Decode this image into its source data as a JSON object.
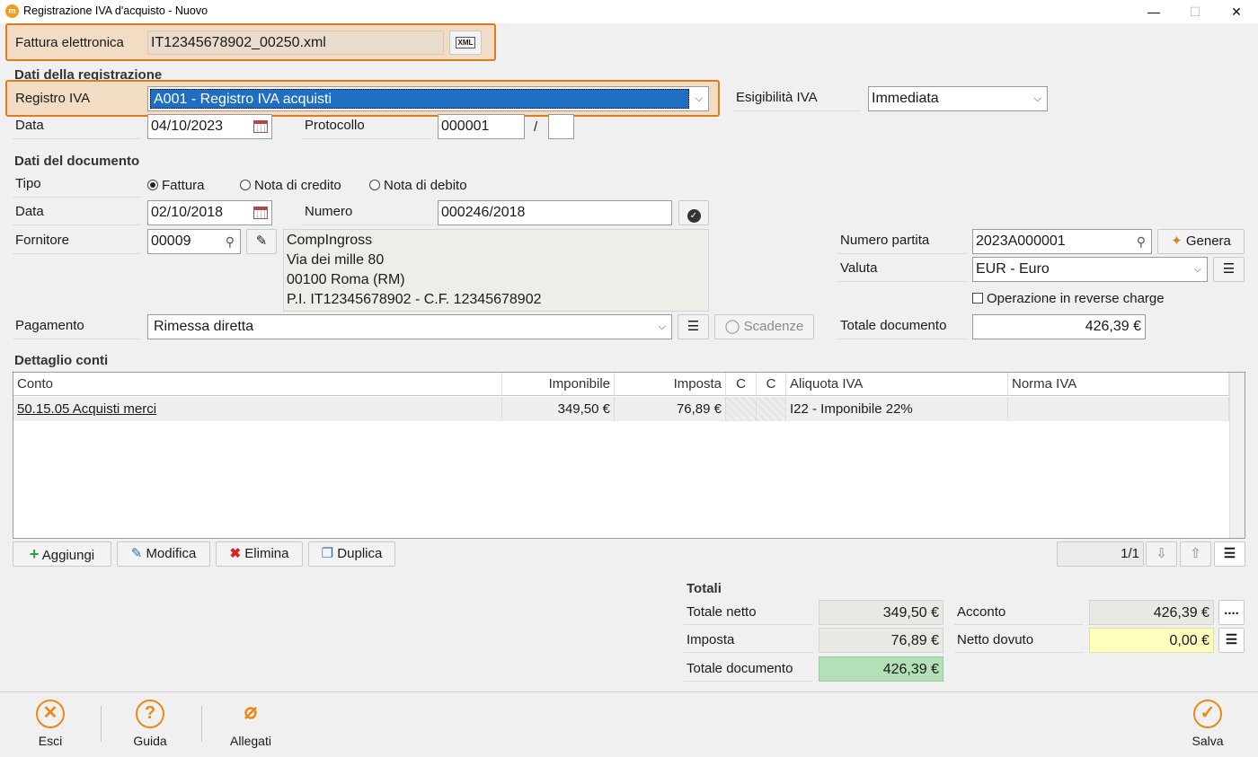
{
  "window": {
    "title": "Registrazione IVA d'acquisto - Nuovo",
    "minimize": "—",
    "maximize": "☐",
    "close": "✕"
  },
  "fattura": {
    "label": "Fattura elettronica",
    "value": "IT12345678902_00250.xml",
    "xml_btn": "XML"
  },
  "registrazione": {
    "section": "Dati della registrazione",
    "registro_label": "Registro IVA",
    "registro_value": "A001 - Registro IVA acquisti",
    "esigibilita_label": "Esigibilità IVA",
    "esigibilita_value": "Immediata",
    "data_label": "Data",
    "data_value": "04/10/2023",
    "protocollo_label": "Protocollo",
    "protocollo_value": "000001",
    "protocollo_sep": "/",
    "protocollo_suffix": ""
  },
  "documento": {
    "section": "Dati del documento",
    "tipo_label": "Tipo",
    "tipi": [
      "Fattura",
      "Nota di credito",
      "Nota di debito"
    ],
    "tipo_selected": "Fattura",
    "data_label": "Data",
    "data_value": "02/10/2018",
    "numero_label": "Numero",
    "numero_value": "000246/2018",
    "fornitore_label": "Fornitore",
    "fornitore_code": "00009",
    "fornitore_lines": [
      "CompIngross",
      "Via dei mille 80",
      "00100 Roma (RM)",
      "P.I. IT12345678902 - C.F. 12345678902"
    ],
    "numero_partita_label": "Numero partita",
    "numero_partita_value": "2023A000001",
    "genera_label": "Genera",
    "valuta_label": "Valuta",
    "valuta_value": "EUR - Euro",
    "reverse_charge_label": "Operazione in reverse charge",
    "pagamento_label": "Pagamento",
    "pagamento_value": "Rimessa diretta",
    "scadenze_label": "Scadenze",
    "totale_documento_label": "Totale documento",
    "totale_documento_value": "426,39 €"
  },
  "conti": {
    "section": "Dettaglio conti",
    "columns": [
      "Conto",
      "Imponibile",
      "Imposta",
      "C",
      "C",
      "Aliquota IVA",
      "Norma IVA"
    ],
    "rows": [
      {
        "conto": "50.15.05 Acquisti merci",
        "imponibile": "349,50 €",
        "imposta": "76,89 €",
        "c1": "",
        "c2": "",
        "aliquota": "I22 - Imponibile 22%",
        "norma": ""
      }
    ],
    "actions": [
      "Aggiungi",
      "Modifica",
      "Elimina",
      "Duplica"
    ],
    "pagination": "1/1"
  },
  "totali": {
    "section": "Totali",
    "netto_label": "Totale netto",
    "netto_value": "349,50 €",
    "imposta_label": "Imposta",
    "imposta_value": "76,89 €",
    "documento_label": "Totale documento",
    "documento_value": "426,39 €",
    "acconto_label": "Acconto",
    "acconto_value": "426,39 €",
    "dovuto_label": "Netto dovuto",
    "dovuto_value": "0,00 €",
    "more_btn": "...."
  },
  "footer": {
    "esci": "Esci",
    "guida": "Guida",
    "allegati": "Allegati",
    "salva": "Salva"
  },
  "colors": {
    "accent": "#e88a1a",
    "selection": "#1e6fc4",
    "total_green": "#b4e0b8",
    "dovuto_yellow": "#ffffc0"
  }
}
